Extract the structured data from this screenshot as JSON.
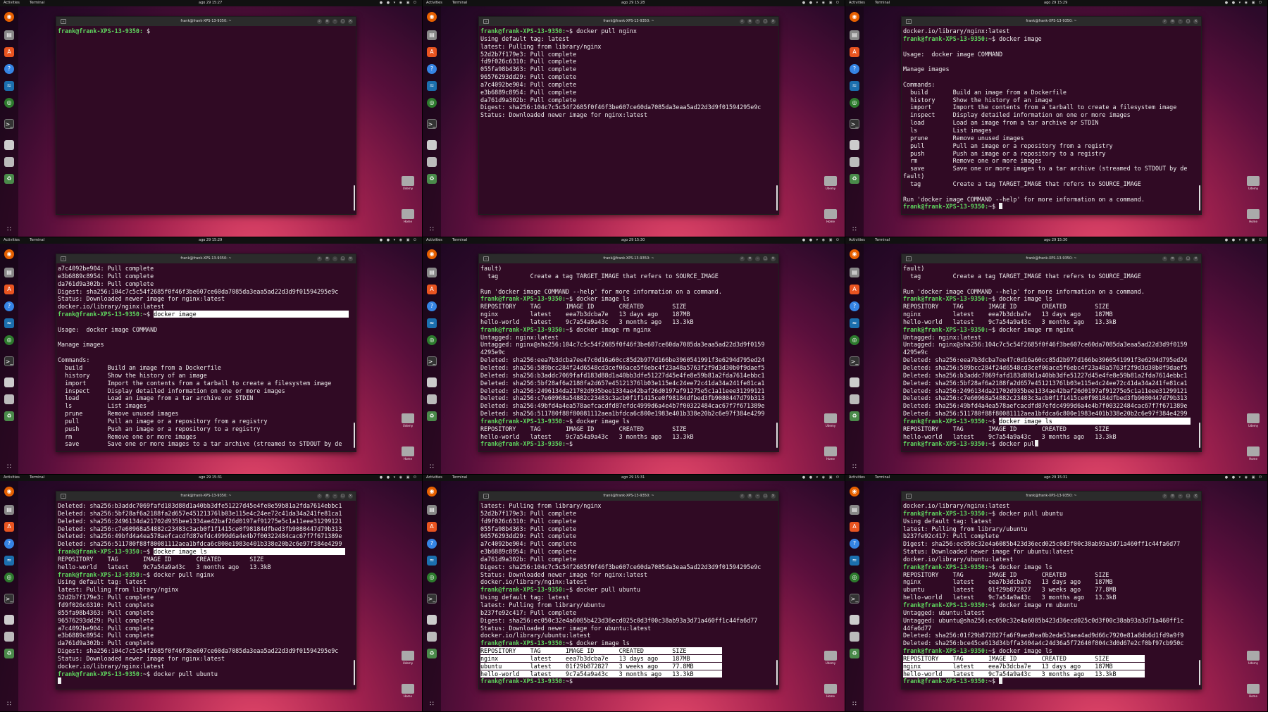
{
  "topbar": {
    "activities": "Activities",
    "app": "Terminal"
  },
  "clocks": [
    "ago 29 15:27",
    "ago 29 15:28",
    "ago 29 15:29",
    "ago 29 15:29",
    "ago 29 15:30",
    "ago 29 15:30",
    "ago 29 15:31",
    "ago 29 15:31",
    "ago 29 15:31"
  ],
  "window_title": "frank@frank-XPS-13-9350: ~",
  "desktop": {
    "udemy": "Udemy",
    "home": "Home"
  },
  "panes": [
    [
      {
        "p": "frank@frank-XPS-13-9350:",
        "t": " $"
      }
    ],
    [
      {
        "p": "frank@frank-XPS-13-9350:",
        "t": "~$ docker pull nginx"
      },
      {
        "t": "Using default tag: latest"
      },
      {
        "t": "latest: Pulling from library/nginx"
      },
      {
        "t": "52d2b7f179e3: Pull complete"
      },
      {
        "t": "fd9f026c6310: Pull complete"
      },
      {
        "t": "055fa98b4363: Pull complete"
      },
      {
        "t": "96576293dd29: Pull complete"
      },
      {
        "t": "a7c4092be904: Pull complete"
      },
      {
        "t": "e3b6889c8954: Pull complete"
      },
      {
        "t": "da761d9a302b: Pull complete"
      },
      {
        "t": "Digest: sha256:104c7c5c54f2685f0f46f3be607ce60da7085da3eaa5ad22d3d9f01594295e9c"
      },
      {
        "t": "Status: Downloaded newer image for nginx:latest"
      }
    ],
    [
      {
        "t": "docker.io/library/nginx:latest"
      },
      {
        "p": "frank@frank-XPS-13-9350:",
        "t": "~$ docker image"
      },
      {
        "t": ""
      },
      {
        "t": "Usage:  docker image COMMAND"
      },
      {
        "t": ""
      },
      {
        "t": "Manage images"
      },
      {
        "t": ""
      },
      {
        "t": "Commands:"
      },
      {
        "t": "  build       Build an image from a Dockerfile"
      },
      {
        "t": "  history     Show the history of an image"
      },
      {
        "t": "  import      Import the contents from a tarball to create a filesystem image"
      },
      {
        "t": "  inspect     Display detailed information on one or more images"
      },
      {
        "t": "  load        Load an image from a tar archive or STDIN"
      },
      {
        "t": "  ls          List images"
      },
      {
        "t": "  prune       Remove unused images"
      },
      {
        "t": "  pull        Pull an image or a repository from a registry"
      },
      {
        "t": "  push        Push an image or a repository to a registry"
      },
      {
        "t": "  rm          Remove one or more images"
      },
      {
        "t": "  save        Save one or more images to a tar archive (streamed to STDOUT by de"
      },
      {
        "t": "fault)"
      },
      {
        "t": "  tag         Create a tag TARGET_IMAGE that refers to SOURCE_IMAGE"
      },
      {
        "t": ""
      },
      {
        "t": "Run 'docker image COMMAND --help' for more information on a command."
      },
      {
        "p": "frank@frank-XPS-13-9350:",
        "t": "~$ ",
        "caret": true
      }
    ],
    [
      {
        "t": "a7c4092be904: Pull complete"
      },
      {
        "t": "e3b6889c8954: Pull complete"
      },
      {
        "t": "da761d9a302b: Pull complete"
      },
      {
        "t": "Digest: sha256:104c7c5c54f2685f0f46f3be607ce60da7085da3eaa5ad22d3d9f01594295e9c"
      },
      {
        "t": "Status: Downloaded newer image for nginx:latest"
      },
      {
        "t": "docker.io/library/nginx:latest"
      },
      {
        "p": "frank@frank-XPS-13-9350:",
        "t": "~$ ",
        "h": "docker image                                           "
      },
      {
        "t": ""
      },
      {
        "t": "Usage:  docker image COMMAND"
      },
      {
        "t": ""
      },
      {
        "t": "Manage images"
      },
      {
        "t": ""
      },
      {
        "t": "Commands:"
      },
      {
        "t": "  build       Build an image from a Dockerfile"
      },
      {
        "t": "  history     Show the history of an image"
      },
      {
        "t": "  import      Import the contents from a tarball to create a filesystem image"
      },
      {
        "t": "  inspect     Display detailed information on one or more images"
      },
      {
        "t": "  load        Load an image from a tar archive or STDIN"
      },
      {
        "t": "  ls          List images"
      },
      {
        "t": "  prune       Remove unused images"
      },
      {
        "t": "  pull        Pull an image or a repository from a registry"
      },
      {
        "t": "  push        Push an image or a repository to a registry"
      },
      {
        "t": "  rm          Remove one or more images"
      },
      {
        "t": "  save        Save one or more images to a tar archive (streamed to STDOUT by de"
      }
    ],
    [
      {
        "t": "fault)"
      },
      {
        "t": "  tag         Create a tag TARGET_IMAGE that refers to SOURCE_IMAGE"
      },
      {
        "t": ""
      },
      {
        "t": "Run 'docker image COMMAND --help' for more information on a command."
      },
      {
        "p": "frank@frank-XPS-13-9350:",
        "t": "~$ docker image ls"
      },
      {
        "t": "REPOSITORY    TAG       IMAGE ID       CREATED        SIZE"
      },
      {
        "t": "nginx         latest    eea7b3dcba7e   13 days ago    187MB"
      },
      {
        "t": "hello-world   latest    9c7a54a9a43c   3 months ago   13.3kB"
      },
      {
        "p": "frank@frank-XPS-13-9350:",
        "t": "~$ docker image rm nginx"
      },
      {
        "t": "Untagged: nginx:latest"
      },
      {
        "t": "Untagged: nginx@sha256:104c7c5c54f2685f0f46f3be607ce60da7085da3eaa5ad22d3d9f0159"
      },
      {
        "t": "4295e9c"
      },
      {
        "t": "Deleted: sha256:eea7b3dcba7ee47c0d16a60cc85d2b977d166be3960541991f3e6294d795ed24"
      },
      {
        "t": "Deleted: sha256:589bcc284f24d6548cd3cef06ace5f6ebc4f23a48a5763f2f9d3d30b0f9daef5"
      },
      {
        "t": "Deleted: sha256:b3addc7069fafd183d88d1a40bb3dfe51227d45e4fe8e59b81a2fda7614ebbc1"
      },
      {
        "t": "Deleted: sha256:5bf28af6a2188fa2d657e45121376lb03e115e4c24ee72c41da34a241fe81ca1"
      },
      {
        "t": "Deleted: sha256:2496134da21702d935bee1334ae42baf26d0197af91275e5c1a11eee31299121"
      },
      {
        "t": "Deleted: sha256:c7e60968a54882c23483c3acb0f1f1415ce0f98184dfbed3fb9080447d79b313"
      },
      {
        "t": "Deleted: sha256:49bfd4a4ea578aefcacdfd87efdc4999d6a4e4b7f00322484cac67f7f671389e"
      },
      {
        "t": "Deleted: sha256:511780f88f80081112aea1bfdca6c800e1983e401b338e20b2c6e97f384e4299"
      },
      {
        "p": "frank@frank-XPS-13-9350:",
        "t": "~$ docker image ls"
      },
      {
        "t": "REPOSITORY    TAG       IMAGE ID       CREATED        SIZE"
      },
      {
        "t": "hello-world   latest    9c7a54a9a43c   3 months ago   13.3kB"
      },
      {
        "p": "frank@frank-XPS-13-9350:",
        "t": "~$ "
      }
    ],
    [
      {
        "t": "fault)"
      },
      {
        "t": "  tag         Create a tag TARGET_IMAGE that refers to SOURCE_IMAGE"
      },
      {
        "t": ""
      },
      {
        "t": "Run 'docker image COMMAND --help' for more information on a command."
      },
      {
        "p": "frank@frank-XPS-13-9350:",
        "t": "~$ docker image ls"
      },
      {
        "t": "REPOSITORY    TAG       IMAGE ID       CREATED        SIZE"
      },
      {
        "t": "nginx         latest    eea7b3dcba7e   13 days ago    187MB"
      },
      {
        "t": "hello-world   latest    9c7a54a9a43c   3 months ago   13.3kB"
      },
      {
        "p": "frank@frank-XPS-13-9350:",
        "t": "~$ docker image rm nginx"
      },
      {
        "t": "Untagged: nginx:latest"
      },
      {
        "t": "Untagged: nginx@sha256:104c7c5c54f2685f0f46f3be607ce60da7085da3eaa5ad22d3d9f0159"
      },
      {
        "t": "4295e9c"
      },
      {
        "t": "Deleted: sha256:eea7b3dcba7ee47c0d16a60cc85d2b977d166be3960541991f3e6294d795ed24"
      },
      {
        "t": "Deleted: sha256:589bcc284f24d6548cd3cef06ace5f6ebc4f23a48a5763f2f9d3d30b0f9daef5"
      },
      {
        "t": "Deleted: sha256:b3addc7069fafd183d88d1a40bb3dfe51227d45e4fe8e59b81a2fda7614ebbc1"
      },
      {
        "t": "Deleted: sha256:5bf28af6a2188fa2d657e45121376lb03e115e4c24ee72c41da34a241fe81ca1"
      },
      {
        "t": "Deleted: sha256:2496134da21702d935bee1334ae42baf26d0197af91275e5c1a11eee31299121"
      },
      {
        "t": "Deleted: sha256:c7e60968a54882c23483c3acb0f1f1415ce0f98184dfbed3fb9080447d79b313"
      },
      {
        "t": "Deleted: sha256:49bfd4a4ea578aefcacdfd87efdc4999d6a4e4b7f00322484cac67f7f671389e"
      },
      {
        "t": "Deleted: sha256:511780f88f80081112aea1bfdca6c800e1983e401b338e20b2c6e97f384e4299"
      },
      {
        "p": "frank@frank-XPS-13-9350:",
        "t": "~$ ",
        "h": "docker image ls                                       "
      },
      {
        "t": "REPOSITORY    TAG       IMAGE ID       CREATED        SIZE"
      },
      {
        "t": "hello-world   latest    9c7a54a9a43c   3 months ago   13.3kB"
      },
      {
        "p": "frank@frank-XPS-13-9350:",
        "t": "~$ docker pul",
        "caret": true
      }
    ],
    [
      {
        "t": "Deleted: sha256:b3addc7069fafd183d88d1a40bb3dfe51227d45e4fe8e59b81a2fda7614ebbc1"
      },
      {
        "t": "Deleted: sha256:5bf28af6a2188fa2d657e45121376lb03e115e4c24ee72c41da34a241fe81ca1"
      },
      {
        "t": "Deleted: sha256:2496134da21702d935bee1334ae42baf26d0197af91275e5c1a11eee31299121"
      },
      {
        "t": "Deleted: sha256:c7e60968a54882c23483c3acb0f1f1415ce0f98184dfbed3fb9080447d79b313"
      },
      {
        "t": "Deleted: sha256:49bfd4a4ea578aefcacdfd87efdc4999d6a4e4b7f00322484cac67f7f671389e"
      },
      {
        "t": "Deleted: sha256:511780f88f80081112aea1bfdca6c800e1983e401b338e20b2c6e97f384e4299"
      },
      {
        "p": "frank@frank-XPS-13-9350:",
        "t": "~$ ",
        "h": "docker image ls                                       "
      },
      {
        "t": "REPOSITORY    TAG       IMAGE ID       CREATED        SIZE"
      },
      {
        "t": "hello-world   latest    9c7a54a9a43c   3 months ago   13.3kB"
      },
      {
        "p": "frank@frank-XPS-13-9350:",
        "t": "~$ docker pull nginx"
      },
      {
        "t": "Using default tag: latest"
      },
      {
        "t": "latest: Pulling from library/nginx"
      },
      {
        "t": "52d2b7f179e3: Pull complete"
      },
      {
        "t": "fd9f026c6310: Pull complete"
      },
      {
        "t": "055fa98b4363: Pull complete"
      },
      {
        "t": "96576293dd29: Pull complete"
      },
      {
        "t": "a7c4092be904: Pull complete"
      },
      {
        "t": "e3b6889c8954: Pull complete"
      },
      {
        "t": "da761d9a302b: Pull complete"
      },
      {
        "t": "Digest: sha256:104c7c5c54f2685f0f46f3be607ce60da7085da3eaa5ad22d3d9f01594295e9c"
      },
      {
        "t": "Status: Downloaded newer image for nginx:latest"
      },
      {
        "t": "docker.io/library/nginx:latest"
      },
      {
        "p": "frank@frank-XPS-13-9350:",
        "t": "~$ docker pull ubuntu"
      },
      {
        "t": "",
        "caret": true
      }
    ],
    [
      {
        "t": "latest: Pulling from library/nginx"
      },
      {
        "t": "52d2b7f179e3: Pull complete"
      },
      {
        "t": "fd9f026c6310: Pull complete"
      },
      {
        "t": "055fa98b4363: Pull complete"
      },
      {
        "t": "96576293dd29: Pull complete"
      },
      {
        "t": "a7c4092be904: Pull complete"
      },
      {
        "t": "e3b6889c8954: Pull complete"
      },
      {
        "t": "da761d9a302b: Pull complete"
      },
      {
        "t": "Digest: sha256:104c7c5c54f2685f0f46f3be607ce60da7085da3eaa5ad22d3d9f01594295e9c"
      },
      {
        "t": "Status: Downloaded newer image for nginx:latest"
      },
      {
        "t": "docker.io/library/nginx:latest"
      },
      {
        "p": "frank@frank-XPS-13-9350:",
        "t": "~$ docker pull ubuntu"
      },
      {
        "t": "Using default tag: latest"
      },
      {
        "t": "latest: Pulling from library/ubuntu"
      },
      {
        "t": "b237fe92c417: Pull complete"
      },
      {
        "t": "Digest: sha256:ec050c32e4a6085b423d36ecd025c0d3f00c38ab93a3d71a460ff1c44fa6d77"
      },
      {
        "t": "Status: Downloaded newer image for ubuntu:latest"
      },
      {
        "t": "docker.io/library/ubuntu:latest"
      },
      {
        "p": "frank@frank-XPS-13-9350:",
        "t": "~$ docker image ls"
      },
      {
        "h": "REPOSITORY    TAG       IMAGE ID       CREATED        SIZE          "
      },
      {
        "h": "nginx         latest    eea7b3dcba7e   13 days ago    187MB         "
      },
      {
        "h": "ubuntu        latest    01f29b872827   3 weeks ago    77.8MB        "
      },
      {
        "h": "hello-world   latest    9c7a54a9a43c   3 months ago   13.3kB        "
      },
      {
        "p": "frank@frank-XPS-13-9350:",
        "t": "~$ "
      }
    ],
    [
      {
        "t": "docker.io/library/nginx:latest"
      },
      {
        "p": "frank@frank-XPS-13-9350:",
        "t": "~$ docker pull ubuntu"
      },
      {
        "t": "Using default tag: latest"
      },
      {
        "t": "latest: Pulling from library/ubuntu"
      },
      {
        "t": "b237fe92c417: Pull complete"
      },
      {
        "t": "Digest: sha256:ec050c32e4a6085b423d36ecd025c0d3f00c38ab93a3d71a460ff1c44fa6d77"
      },
      {
        "t": "Status: Downloaded newer image for ubuntu:latest"
      },
      {
        "t": "docker.io/library/ubuntu:latest"
      },
      {
        "p": "frank@frank-XPS-13-9350:",
        "t": "~$ docker image ls"
      },
      {
        "t": "REPOSITORY    TAG       IMAGE ID       CREATED        SIZE"
      },
      {
        "t": "nginx         latest    eea7b3dcba7e   13 days ago    187MB"
      },
      {
        "t": "ubuntu        latest    01f29b872827   3 weeks ago    77.8MB"
      },
      {
        "t": "hello-world   latest    9c7a54a9a43c   3 months ago   13.3kB"
      },
      {
        "p": "frank@frank-XPS-13-9350:",
        "t": "~$ docker image rm ubuntu"
      },
      {
        "t": "Untagged: ubuntu:latest"
      },
      {
        "t": "Untagged: ubuntu@sha256:ec050c32e4a6085b423d36ecd025c0d3f00c38ab93a3d71a460ff1c"
      },
      {
        "t": "44fa6d77"
      },
      {
        "t": "Deleted: sha256:01f29b872827fa6f9aed0ea0b2ede53aea4ad9d66c7920e81a8db6d1fd9a9f9"
      },
      {
        "t": "Deleted: sha256:bce45ce613d34bffa3404a4c24d36a5f72640f804c3d0d67e2cf0bf97cb950c"
      },
      {
        "p": "frank@frank-XPS-13-9350:",
        "t": "~$ docker image ls"
      },
      {
        "h": "REPOSITORY    TAG       IMAGE ID       CREATED        SIZE          "
      },
      {
        "h": "nginx         latest    eea7b3dcba7e   13 days ago    187MB         "
      },
      {
        "h": "hello-world   latest    9c7a54a9a43c   3 months ago   13.3kB        "
      },
      {
        "p": "frank@frank-XPS-13-9350:",
        "t": "~$ ",
        "caret": true
      }
    ]
  ]
}
